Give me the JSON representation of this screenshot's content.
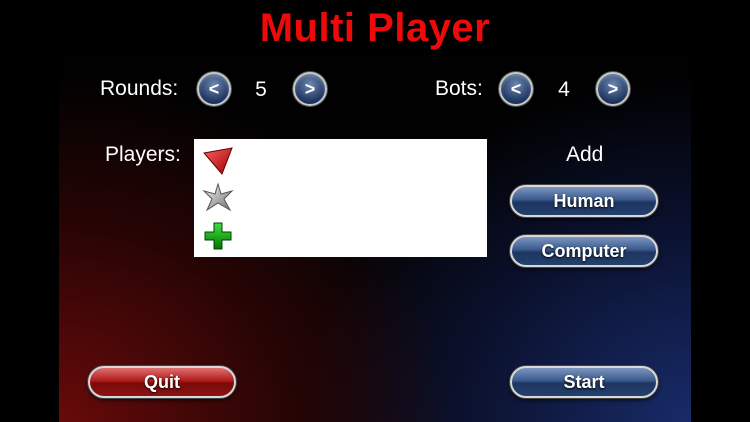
{
  "title": "Multi Player",
  "rounds": {
    "label": "Rounds:",
    "value": "5",
    "dec": "<",
    "inc": ">"
  },
  "bots": {
    "label": "Bots:",
    "value": "4",
    "dec": "<",
    "inc": ">"
  },
  "players": {
    "label": "Players:",
    "items": [
      {
        "icon": "red-triangle-icon",
        "color": "#dd1111"
      },
      {
        "icon": "silver-star-icon",
        "color": "#b0b0b0"
      },
      {
        "icon": "green-cross-icon",
        "color": "#11aa11"
      }
    ]
  },
  "add": {
    "label": "Add",
    "human": "Human",
    "computer": "Computer"
  },
  "quit": "Quit",
  "start": "Start"
}
